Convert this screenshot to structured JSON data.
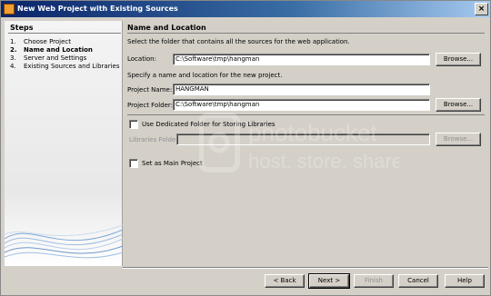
{
  "window": {
    "title": "New Web Project with Existing Sources",
    "close_glyph": "×"
  },
  "steps": {
    "title": "Steps",
    "items": [
      {
        "num": "1.",
        "label": "Choose Project"
      },
      {
        "num": "2.",
        "label": "Name and Location"
      },
      {
        "num": "3.",
        "label": "Server and Settings"
      },
      {
        "num": "4.",
        "label": "Existing Sources and Libraries"
      }
    ]
  },
  "panel": {
    "title": "Name and Location",
    "intro": "Select the folder that contains all the sources for the web application.",
    "location_label": "Location:",
    "location_value": "C:\\Software\\tmp\\hangman",
    "browse1": "Browse...",
    "name_intro": "Specify a name and location for the new project.",
    "project_name_label": "Project Name:",
    "project_name_value": "HANGMAN",
    "project_folder_label": "Project Folder:",
    "project_folder_value": "C:\\Software\\tmp\\hangman",
    "browse2": "Browse...",
    "dedicated_folder_label": "Use Dedicated Folder for Storing Libraries",
    "libraries_folder_label": "Libraries Folder:",
    "libraries_folder_value": "",
    "browse3": "Browse...",
    "set_main_label": "Set as Main Project"
  },
  "footer": {
    "back": "< Back",
    "next": "Next >",
    "finish": "Finish",
    "cancel": "Cancel",
    "help": "Help"
  }
}
